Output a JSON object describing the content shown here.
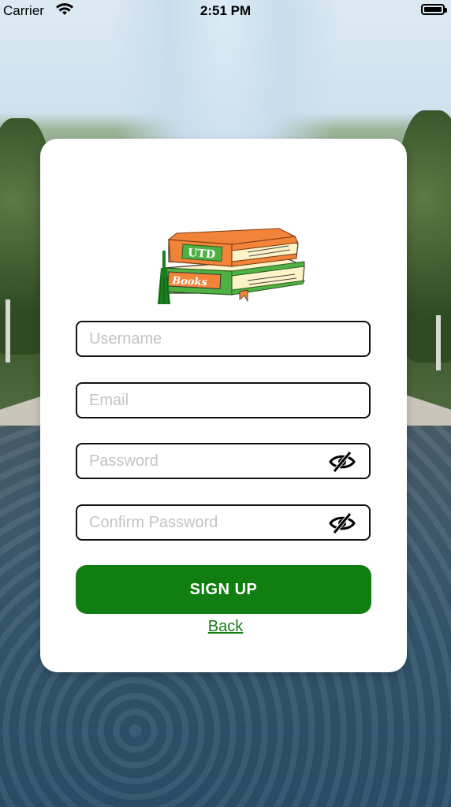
{
  "status_bar": {
    "carrier": "Carrier",
    "time": "2:51 PM",
    "wifi_icon": "wifi-icon",
    "battery_icon": "battery-icon"
  },
  "logo": {
    "top_book_label": "UTD",
    "bottom_book_label": "Books",
    "colors": {
      "orange": "#f2843a",
      "green": "#4fb143",
      "page": "#fdf3c8",
      "tassel": "#1a7d1e"
    }
  },
  "form": {
    "username": {
      "value": "",
      "placeholder": "Username"
    },
    "email": {
      "value": "",
      "placeholder": "Email"
    },
    "password": {
      "value": "",
      "placeholder": "Password",
      "toggle_icon": "eye-slash-icon"
    },
    "confirm_password": {
      "value": "",
      "placeholder": "Confirm Password",
      "toggle_icon": "eye-slash-icon"
    }
  },
  "actions": {
    "signup_label": "SIGN UP",
    "back_label": "Back"
  },
  "colors": {
    "accent": "#117e12",
    "card": "#ffffff",
    "placeholder": "#c3c3c8"
  }
}
